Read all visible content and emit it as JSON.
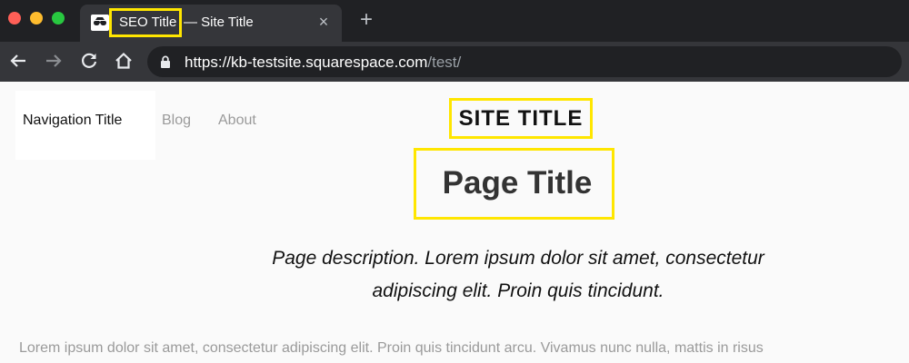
{
  "browser": {
    "tab": {
      "seo_title": "SEO Title",
      "site_title_suffix": "— Site Title",
      "close_glyph": "×"
    },
    "new_tab_glyph": "+",
    "address": {
      "url_host": "https://kb-testsite.squarespace.com",
      "url_path": "/test/"
    },
    "icons": [
      "back-arrow-icon",
      "forward-arrow-icon",
      "reload-icon",
      "home-icon",
      "lock-icon",
      "incognito-icon",
      "close-icon",
      "plus-icon"
    ]
  },
  "site": {
    "nav_title": "Navigation Title",
    "nav_links": [
      "Blog",
      "About"
    ],
    "site_title": "SITE TITLE",
    "page_title": "Page Title",
    "page_description": "Page description. Lorem ipsum dolor sit amet, consectetur adipiscing elit. Proin quis tincidunt.",
    "body_text": "Lorem ipsum dolor sit amet, consectetur adipiscing elit. Proin quis tincidunt arcu. Vivamus nunc nulla, mattis in risus"
  },
  "colors": {
    "highlight": "#ffe600",
    "chrome_dark": "#202124",
    "chrome_tab": "#35363a"
  }
}
